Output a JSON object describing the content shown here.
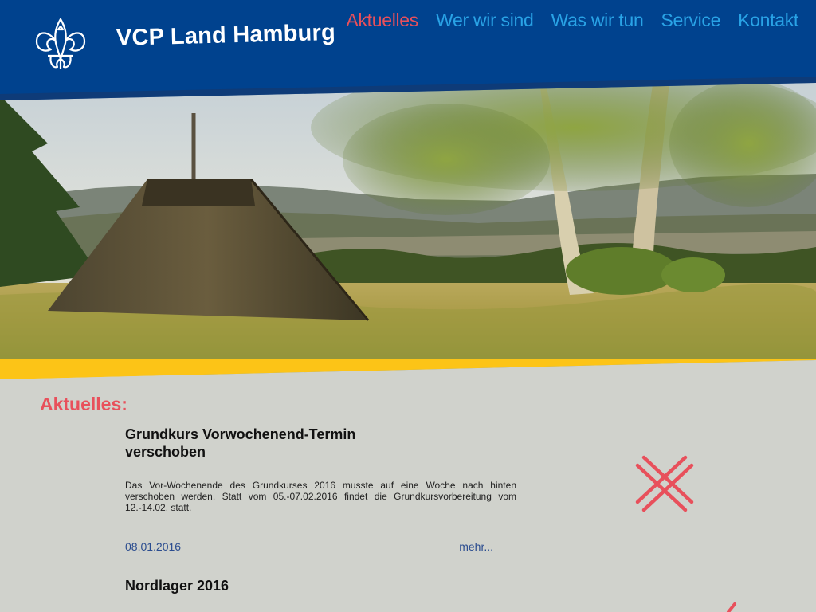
{
  "site": {
    "title": "VCP Land Hamburg",
    "logo_icon": "fleur-de-lis-icon",
    "colors": {
      "header_blue": "#00428e",
      "nav_link": "#29a3e6",
      "nav_active": "#e8505b",
      "accent_yellow": "#fcc417",
      "background": "#d0d2cc",
      "link": "#2a4c8f"
    }
  },
  "nav": {
    "items": [
      {
        "label": "Aktuelles",
        "active": true
      },
      {
        "label": "Wer wir sind",
        "active": false
      },
      {
        "label": "Was wir tun",
        "active": false
      },
      {
        "label": "Service",
        "active": false
      },
      {
        "label": "Kontakt",
        "active": false
      }
    ]
  },
  "main": {
    "section_title": "Aktuelles:",
    "articles": [
      {
        "title": "Grundkurs Vorwochenend-Termin verschoben",
        "text": "Das Vor-Wochenende des Grundkurses 2016 musste auf eine Woche nach hinten verschoben werden. Statt vom 05.-07.02.2016 findet die Grundkursvorbereitung vom 12.-14.02. statt.",
        "date": "08.01.2016",
        "more": "mehr..."
      },
      {
        "title": "Nordlager 2016"
      }
    ]
  }
}
